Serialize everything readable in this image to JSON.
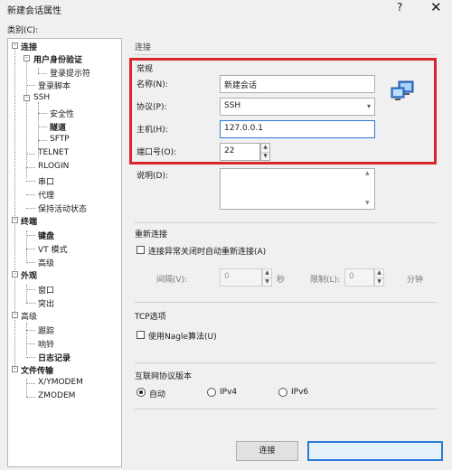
{
  "window": {
    "title": "新建会话属性",
    "help_label": "?",
    "close_label": "✕"
  },
  "category_label": "类别(C):",
  "tree": {
    "items": [
      {
        "label": "连接",
        "bold": true,
        "selected": false
      },
      {
        "label": "用户身份验证",
        "bold": true,
        "selected": false
      },
      {
        "label": "登录提示符",
        "bold": false,
        "selected": false
      },
      {
        "label": "登录脚本",
        "bold": false,
        "selected": false
      },
      {
        "label": "SSH",
        "bold": false,
        "selected": false
      },
      {
        "label": "安全性",
        "bold": false,
        "selected": false
      },
      {
        "label": "隧道",
        "bold": true,
        "selected": false
      },
      {
        "label": "SFTP",
        "bold": false,
        "selected": false
      },
      {
        "label": "TELNET",
        "bold": false,
        "selected": false
      },
      {
        "label": "RLOGIN",
        "bold": false,
        "selected": false
      },
      {
        "label": "串口",
        "bold": false,
        "selected": false
      },
      {
        "label": "代理",
        "bold": false,
        "selected": false
      },
      {
        "label": "保持活动状态",
        "bold": false,
        "selected": false
      },
      {
        "label": "终端",
        "bold": true,
        "selected": false
      },
      {
        "label": "键盘",
        "bold": true,
        "selected": false
      },
      {
        "label": "VT 模式",
        "bold": false,
        "selected": false
      },
      {
        "label": "高级",
        "bold": false,
        "selected": false
      },
      {
        "label": "外观",
        "bold": true,
        "selected": false
      },
      {
        "label": "窗口",
        "bold": false,
        "selected": false
      },
      {
        "label": "突出",
        "bold": false,
        "selected": false
      },
      {
        "label": "高级",
        "bold": false,
        "selected": false
      },
      {
        "label": "跟踪",
        "bold": false,
        "selected": false
      },
      {
        "label": "响铃",
        "bold": false,
        "selected": false
      },
      {
        "label": "日志记录",
        "bold": true,
        "selected": false
      },
      {
        "label": "文件传输",
        "bold": true,
        "selected": false
      },
      {
        "label": "X/YMODEM",
        "bold": false,
        "selected": false
      },
      {
        "label": "ZMODEM",
        "bold": false,
        "selected": false
      }
    ]
  },
  "connection": {
    "header": "连接",
    "general_title": "常规",
    "name_label": "名称(N):",
    "name_value": "新建会话",
    "protocol_label": "协议(P):",
    "protocol_value": "SSH",
    "host_label": "主机(H):",
    "host_value": "127.0.0.1",
    "port_label": "端口号(O):",
    "port_value": "22",
    "desc_label": "说明(D):",
    "desc_value": ""
  },
  "reconnect": {
    "title": "重新连接",
    "auto_label": "连接异常关闭时自动重新连接(A)",
    "auto_checked": false,
    "interval_label": "间隔(V):",
    "interval_value": "0",
    "seconds_label": "秒",
    "limit_label": "限制(L):",
    "limit_value": "0",
    "minutes_label": "分钟"
  },
  "tcp": {
    "title": "TCP选项",
    "nagle_label": "使用Nagle算法(U)",
    "nagle_checked": false
  },
  "ipver": {
    "title": "互联网协议版本",
    "options": [
      {
        "label": "自动",
        "selected": true
      },
      {
        "label": "IPv4",
        "selected": false
      },
      {
        "label": "IPv6",
        "selected": false
      }
    ]
  },
  "buttons": {
    "connect_label": "连接",
    "ok_label": ""
  },
  "colors": {
    "highlight": "#d9262d",
    "focus": "#2b7bd8"
  }
}
